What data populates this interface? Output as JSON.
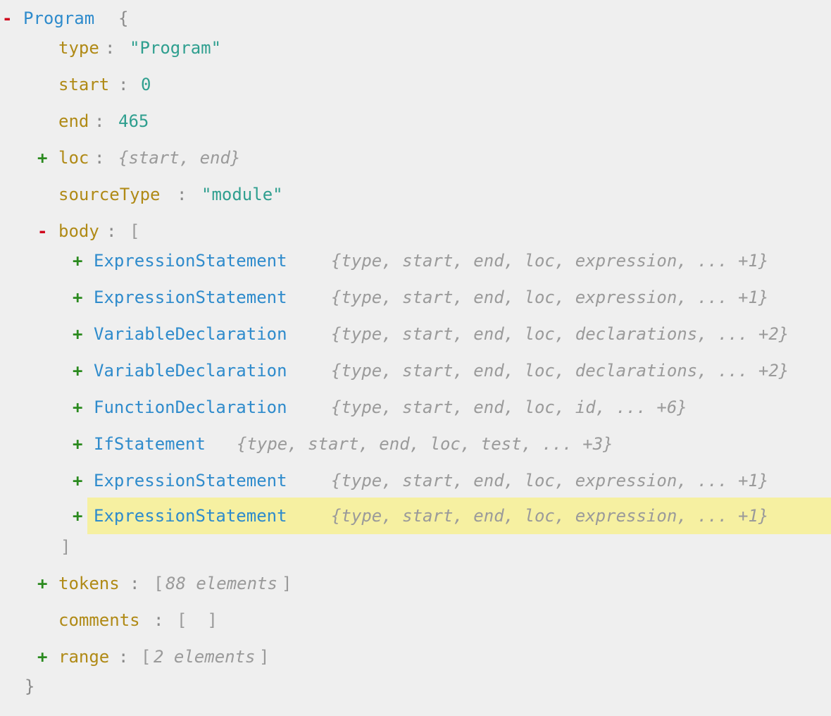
{
  "tree": {
    "root": {
      "toggle": "-",
      "name": "Program",
      "open": "{",
      "close": "}"
    },
    "props": {
      "type": {
        "key": "type",
        "value": "\"Program\""
      },
      "start": {
        "key": "start",
        "value": "0"
      },
      "end": {
        "key": "end",
        "value": "465"
      },
      "loc": {
        "toggle": "+",
        "key": "loc",
        "summary": "{start, end}"
      },
      "sourceType": {
        "key": "sourceType",
        "value": "\"module\""
      },
      "body": {
        "toggle": "-",
        "key": "body",
        "open": "[",
        "close": "]",
        "items": [
          {
            "toggle": "+",
            "name": "ExpressionStatement",
            "summary": "{type, start, end, loc, expression, ... +1}"
          },
          {
            "toggle": "+",
            "name": "ExpressionStatement",
            "summary": "{type, start, end, loc, expression, ... +1}"
          },
          {
            "toggle": "+",
            "name": "VariableDeclaration",
            "summary": "{type, start, end, loc, declarations, ... +2}"
          },
          {
            "toggle": "+",
            "name": "VariableDeclaration",
            "summary": "{type, start, end, loc, declarations, ... +2}"
          },
          {
            "toggle": "+",
            "name": "FunctionDeclaration",
            "summary": "{type, start, end, loc, id, ... +6}"
          },
          {
            "toggle": "+",
            "name": "IfStatement",
            "summary": "{type, start, end, loc, test, ... +3}"
          },
          {
            "toggle": "+",
            "name": "ExpressionStatement",
            "summary": "{type, start, end, loc, expression, ... +1}"
          },
          {
            "toggle": "+",
            "name": "ExpressionStatement",
            "summary": "{type, start, end, loc, expression, ... +1}",
            "highlighted": true
          }
        ]
      },
      "tokens": {
        "toggle": "+",
        "key": "tokens",
        "summary": "88 elements",
        "open": "[",
        "close": "]"
      },
      "comments": {
        "key": "comments",
        "value": "[  ]"
      },
      "range": {
        "toggle": "+",
        "key": "range",
        "summary": "2 elements",
        "open": "[",
        "close": "]"
      }
    },
    "colon": ":"
  },
  "colors": {
    "background": "#efefef",
    "highlight": "#f6f0a1",
    "node": "#2e8bcc",
    "key": "#b08a16",
    "string": "#2f9f8f",
    "minus": "#d0021b",
    "plus": "#2b8a1f"
  }
}
